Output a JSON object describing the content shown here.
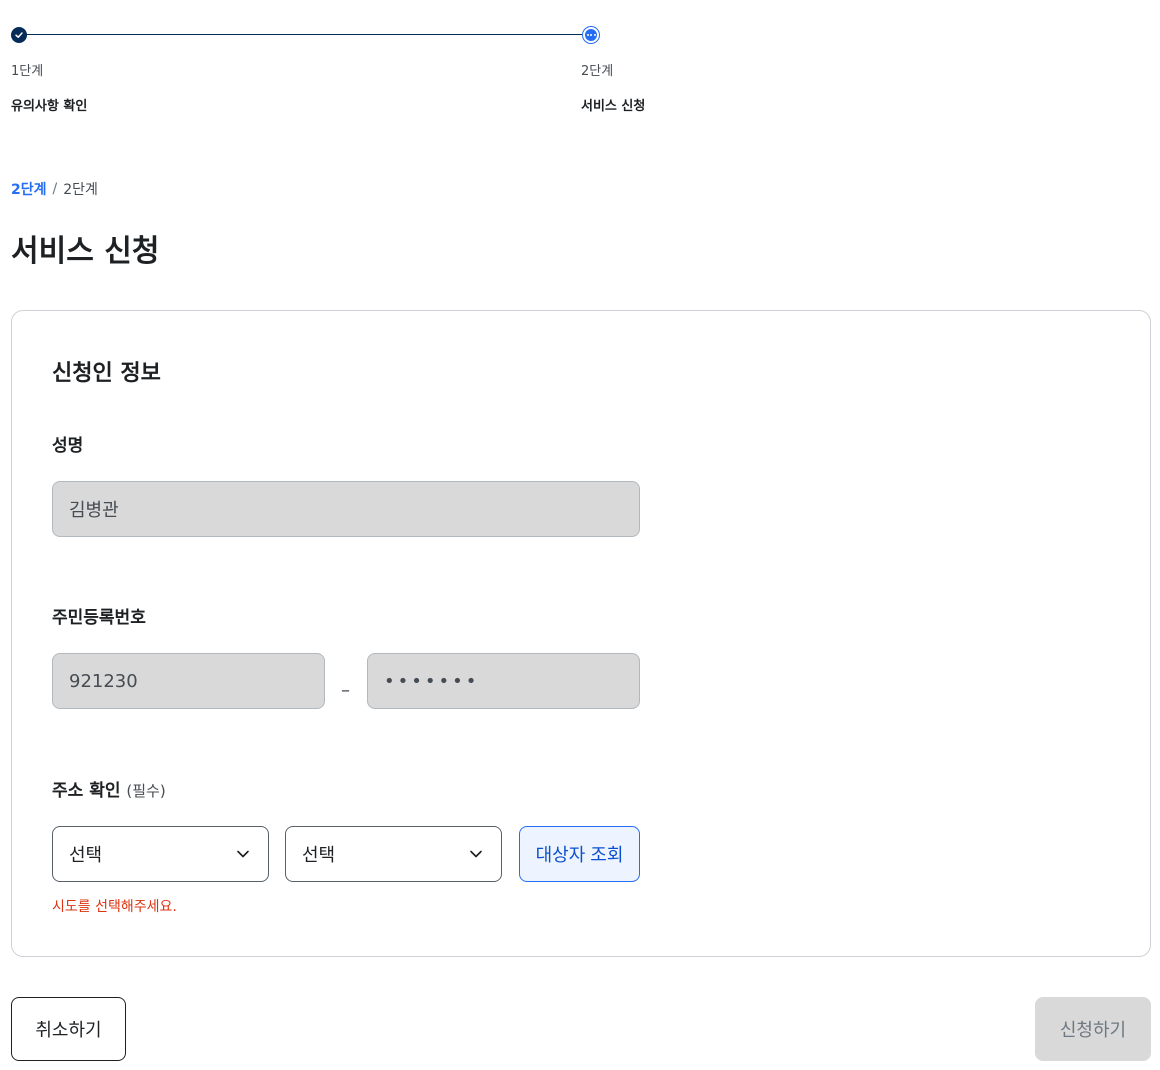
{
  "stepper": {
    "steps": [
      {
        "number": "1단계",
        "name": "유의사항 확인",
        "status": "done"
      },
      {
        "number": "2단계",
        "name": "서비스 신청",
        "status": "current"
      }
    ]
  },
  "breadcrumb": {
    "current": "2단계",
    "separator": "/",
    "total": "2단계"
  },
  "page_title": "서비스 신청",
  "form": {
    "section_title": "신청인 정보",
    "name": {
      "label": "성명",
      "value": "김병관"
    },
    "rrn": {
      "label": "주민등록번호",
      "front": "921230",
      "dash": "–",
      "back": "•••••••"
    },
    "address": {
      "label": "주소 확인",
      "required": "(필수)",
      "select1": "선택",
      "select2": "선택",
      "lookup_label": "대상자 조회",
      "error": "시도를 선택해주세요."
    }
  },
  "buttons": {
    "cancel": "취소하기",
    "submit": "신청하기"
  },
  "colors": {
    "primary": "#256ef4",
    "navy": "#052b57",
    "error": "#de3412",
    "disabled_bg": "#d9d9d9"
  }
}
